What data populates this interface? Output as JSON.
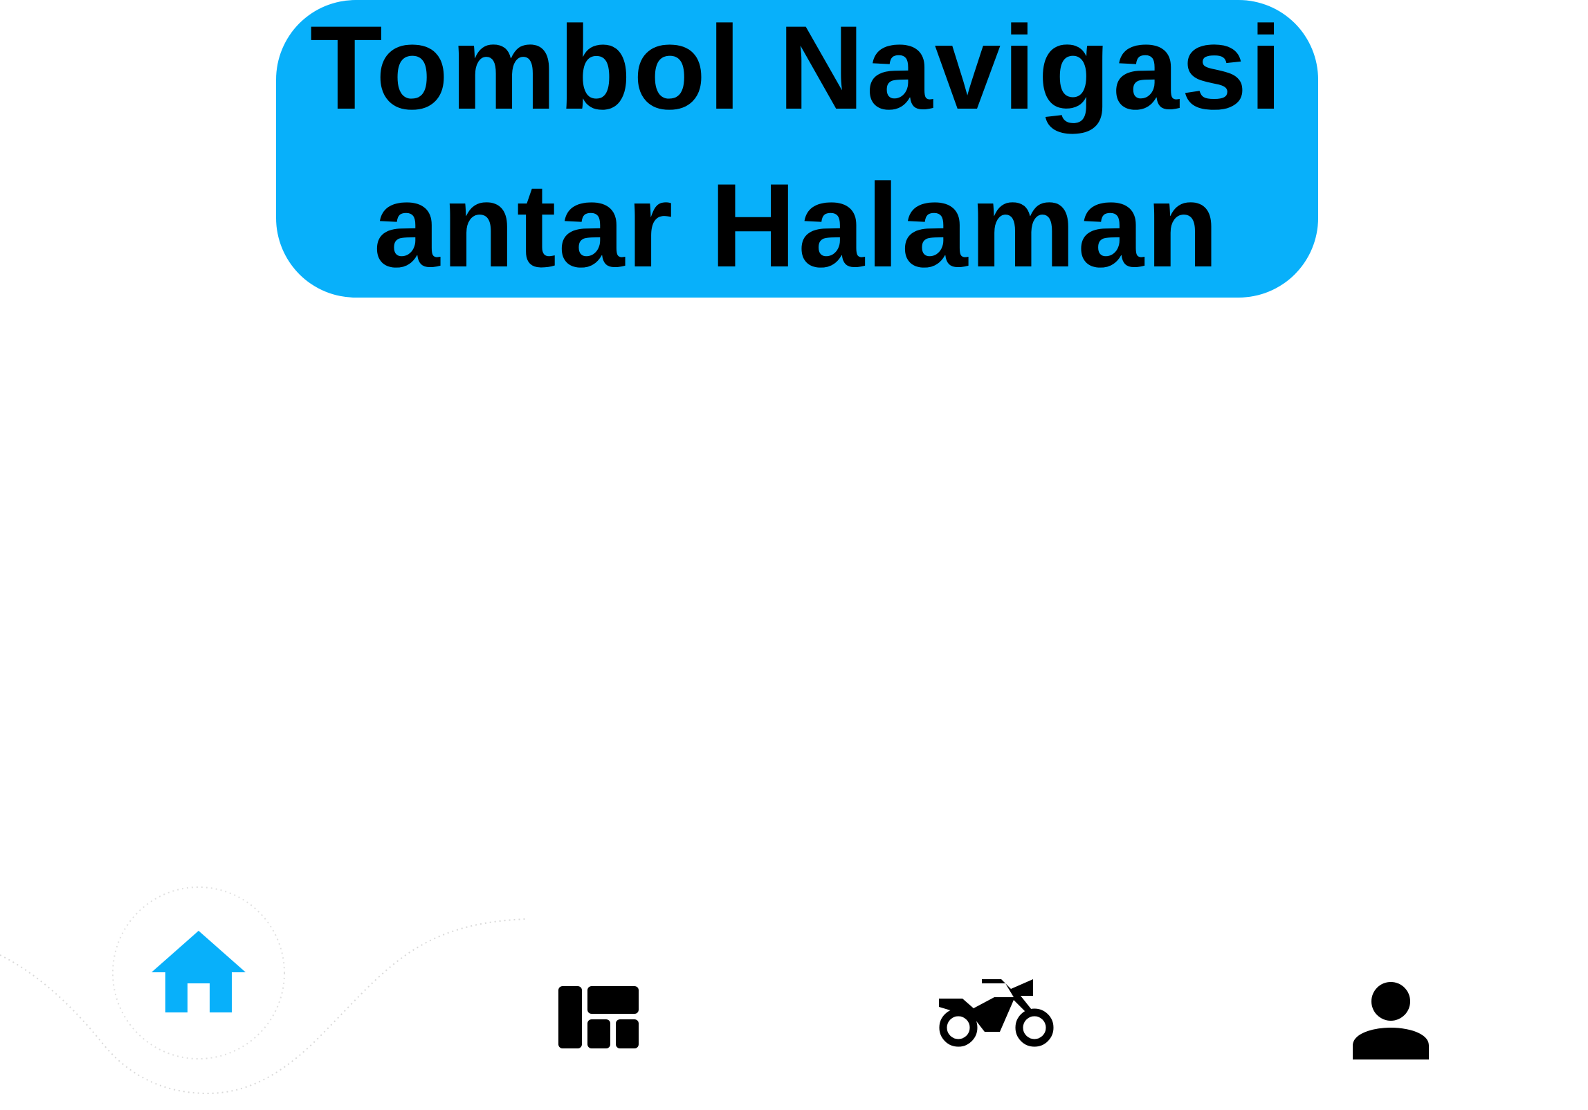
{
  "header": {
    "title": "Tombol Navigasi\nantar Halaman"
  },
  "bottom_nav": {
    "active_index": 0,
    "items": [
      {
        "icon": "home-icon",
        "active": true
      },
      {
        "icon": "dashboard-icon",
        "active": false
      },
      {
        "icon": "motorcycle-icon",
        "active": false
      },
      {
        "icon": "person-icon",
        "active": false
      }
    ]
  },
  "colors": {
    "accent": "#08b0fa",
    "icon_default": "#000000",
    "background": "#ffffff"
  }
}
